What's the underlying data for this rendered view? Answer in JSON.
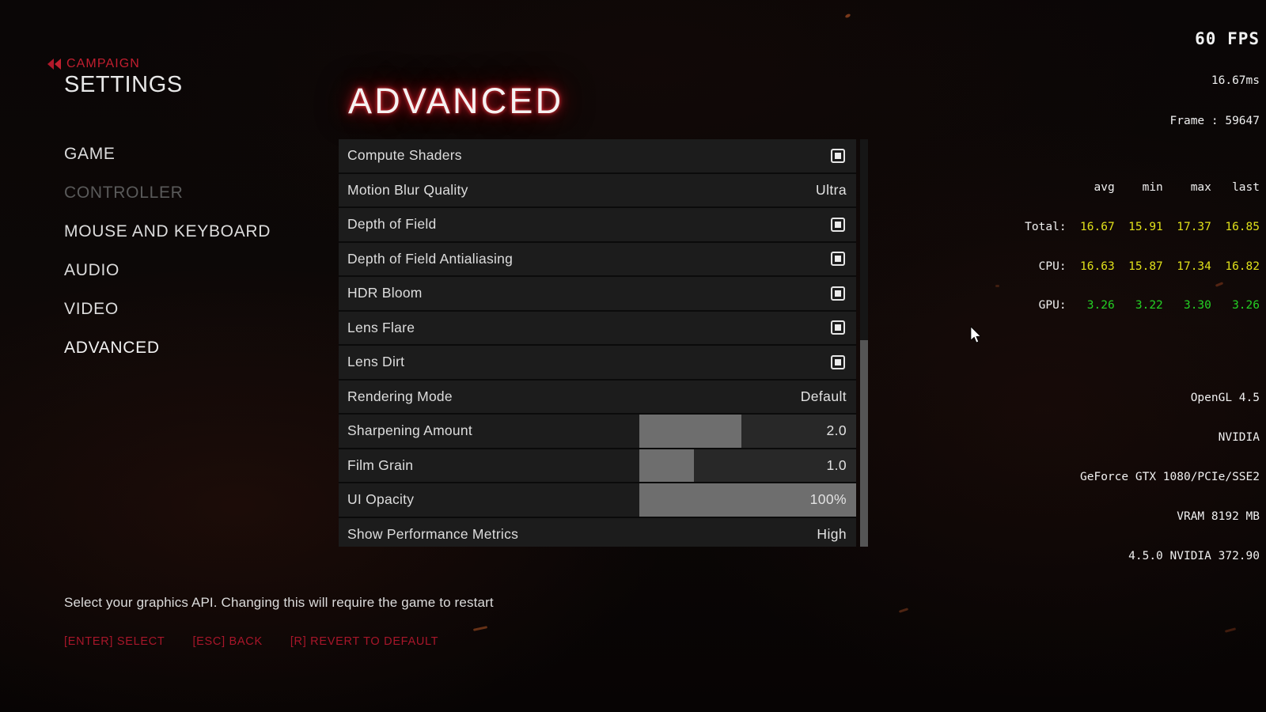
{
  "header": {
    "back_label": "CAMPAIGN",
    "back_icon": "double-chevron-left-icon",
    "title": "SETTINGS",
    "page_heading": "ADVANCED"
  },
  "sidebar": {
    "items": [
      {
        "label": "GAME",
        "state": "normal"
      },
      {
        "label": "CONTROLLER",
        "state": "disabled"
      },
      {
        "label": "MOUSE AND KEYBOARD",
        "state": "normal"
      },
      {
        "label": "AUDIO",
        "state": "normal"
      },
      {
        "label": "VIDEO",
        "state": "normal"
      },
      {
        "label": "ADVANCED",
        "state": "selected"
      }
    ]
  },
  "settings": {
    "rows": [
      {
        "label": "Compute Shaders",
        "control": "checkbox",
        "checked": true
      },
      {
        "label": "Motion Blur Quality",
        "control": "value",
        "value": "Ultra"
      },
      {
        "label": "Depth of Field",
        "control": "checkbox",
        "checked": true
      },
      {
        "label": "Depth of Field Antialiasing",
        "control": "checkbox",
        "checked": true
      },
      {
        "label": "HDR Bloom",
        "control": "checkbox",
        "checked": true
      },
      {
        "label": "Lens Flare",
        "control": "checkbox",
        "checked": true
      },
      {
        "label": "Lens Dirt",
        "control": "checkbox",
        "checked": true
      },
      {
        "label": "Rendering Mode",
        "control": "value",
        "value": "Default"
      },
      {
        "label": "Sharpening Amount",
        "control": "slider",
        "value": "2.0",
        "fill_percent": 47
      },
      {
        "label": "Film Grain",
        "control": "slider",
        "value": "1.0",
        "fill_percent": 25
      },
      {
        "label": "UI Opacity",
        "control": "slider",
        "value": "100%",
        "fill_percent": 100
      },
      {
        "label": "Show Performance Metrics",
        "control": "value",
        "value": "High"
      }
    ]
  },
  "footer": {
    "hint": "Select your graphics API. Changing this will require the game to restart",
    "keys": [
      {
        "label": "[ENTER] SELECT"
      },
      {
        "label": "[ESC] BACK"
      },
      {
        "label": "[R] REVERT TO DEFAULT"
      }
    ]
  },
  "perf_overlay": {
    "fps": "60 FPS",
    "frametime": "16.67ms",
    "frame": "Frame : 59647",
    "columns": [
      "avg",
      "min",
      "max",
      "last"
    ],
    "rows": [
      {
        "name": "Total:",
        "values": [
          "16.67",
          "15.91",
          "17.37",
          "16.85"
        ],
        "color": "#e0e01a"
      },
      {
        "name": "CPU:",
        "values": [
          "16.63",
          "15.87",
          "17.34",
          "16.82"
        ],
        "color": "#e0e01a"
      },
      {
        "name": "GPU:",
        "values": [
          "3.26",
          "3.22",
          "3.30",
          "3.26"
        ],
        "color": "#24d024"
      }
    ],
    "api": "OpenGL 4.5",
    "vendor": "NVIDIA",
    "renderer": "GeForce GTX 1080/PCIe/SSE2",
    "vram": "VRAM 8192 MB",
    "driver": "4.5.0 NVIDIA 372.90"
  },
  "colors": {
    "accent_red": "#c21e2f",
    "hint_red": "#a8162a",
    "row_bg": "#1c1c1c",
    "slider_fill": "#6e6e6e",
    "selected_bg": "#3b3b3b"
  }
}
